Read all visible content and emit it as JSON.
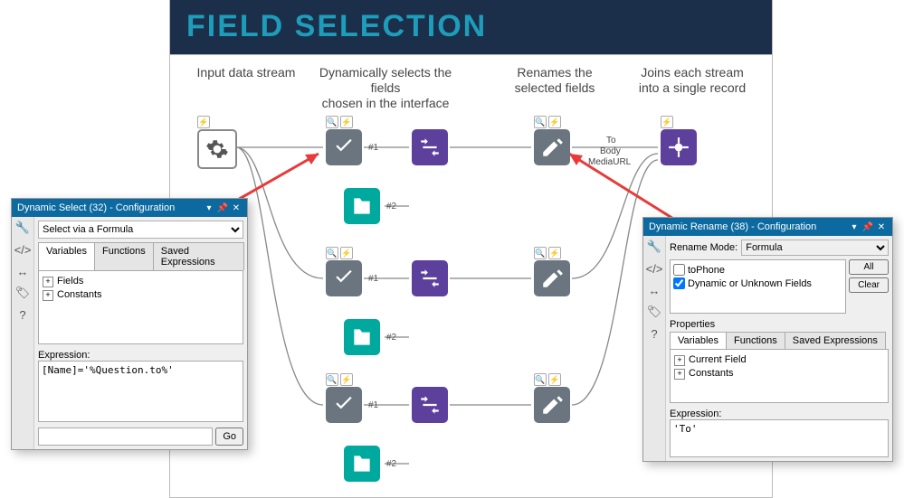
{
  "title": "FIELD SELECTION",
  "labels": {
    "input": "Input data stream",
    "dynselect": "Dynamically selects the fields\nchosen in the interface",
    "rename": "Renames the\nselected fields",
    "join": "Joins each stream\ninto a single record"
  },
  "port_numbers": {
    "one": "#1",
    "two": "#2"
  },
  "field_labels": {
    "to": "To",
    "body": "Body",
    "media": "MediaURL"
  },
  "panel1": {
    "title": "Dynamic Select (32) - Configuration",
    "mode": "Select via a Formula",
    "tabs": [
      "Variables",
      "Functions",
      "Saved Expressions"
    ],
    "tree": [
      "Fields",
      "Constants"
    ],
    "expr_label": "Expression:",
    "expression": "[Name]='%Question.to%'",
    "go": "Go"
  },
  "panel2": {
    "title": "Dynamic Rename (38) - Configuration",
    "mode_label": "Rename Mode:",
    "mode": "Formula",
    "fields": [
      {
        "label": "toPhone",
        "checked": false
      },
      {
        "label": "Dynamic or Unknown Fields",
        "checked": true
      }
    ],
    "all": "All",
    "clear": "Clear",
    "props": "Properties",
    "tabs": [
      "Variables",
      "Functions",
      "Saved Expressions"
    ],
    "tree": [
      "Current Field",
      "Constants"
    ],
    "expr_label": "Expression:",
    "expression": "'To'"
  },
  "icons": {
    "lightning": "⚡",
    "search": "🔍"
  }
}
